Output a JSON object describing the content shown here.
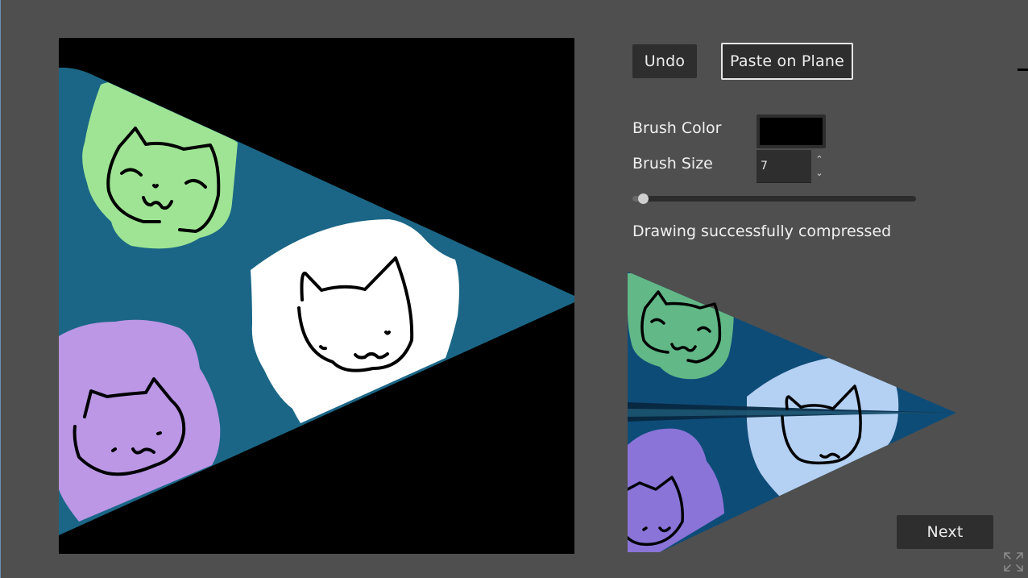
{
  "toolbar": {
    "undo_label": "Undo",
    "paste_label": "Paste on Plane"
  },
  "brush": {
    "color_label": "Brush Color",
    "color_value": "#000000",
    "size_label": "Brush Size",
    "size_value": "7",
    "slider_fraction": 0.02
  },
  "status": {
    "message": "Drawing successfully compressed"
  },
  "footer": {
    "next_label": "Next"
  },
  "icons": {
    "spin_up": "chevron-up-icon",
    "spin_down": "chevron-down-icon",
    "fullscreen": "fullscreen-icon"
  },
  "colors": {
    "background": "#4f4f4f",
    "button": "#2e2e2e",
    "flag_teal": "#1b6686",
    "cat_green": "#9ee494",
    "cat_white": "#ffffff",
    "cat_purple": "#bb97e6",
    "preview_blue": "#0e4c78",
    "preview_green": "#62b887",
    "preview_lightblue": "#b4d0f2",
    "preview_purple": "#8a74d8"
  }
}
